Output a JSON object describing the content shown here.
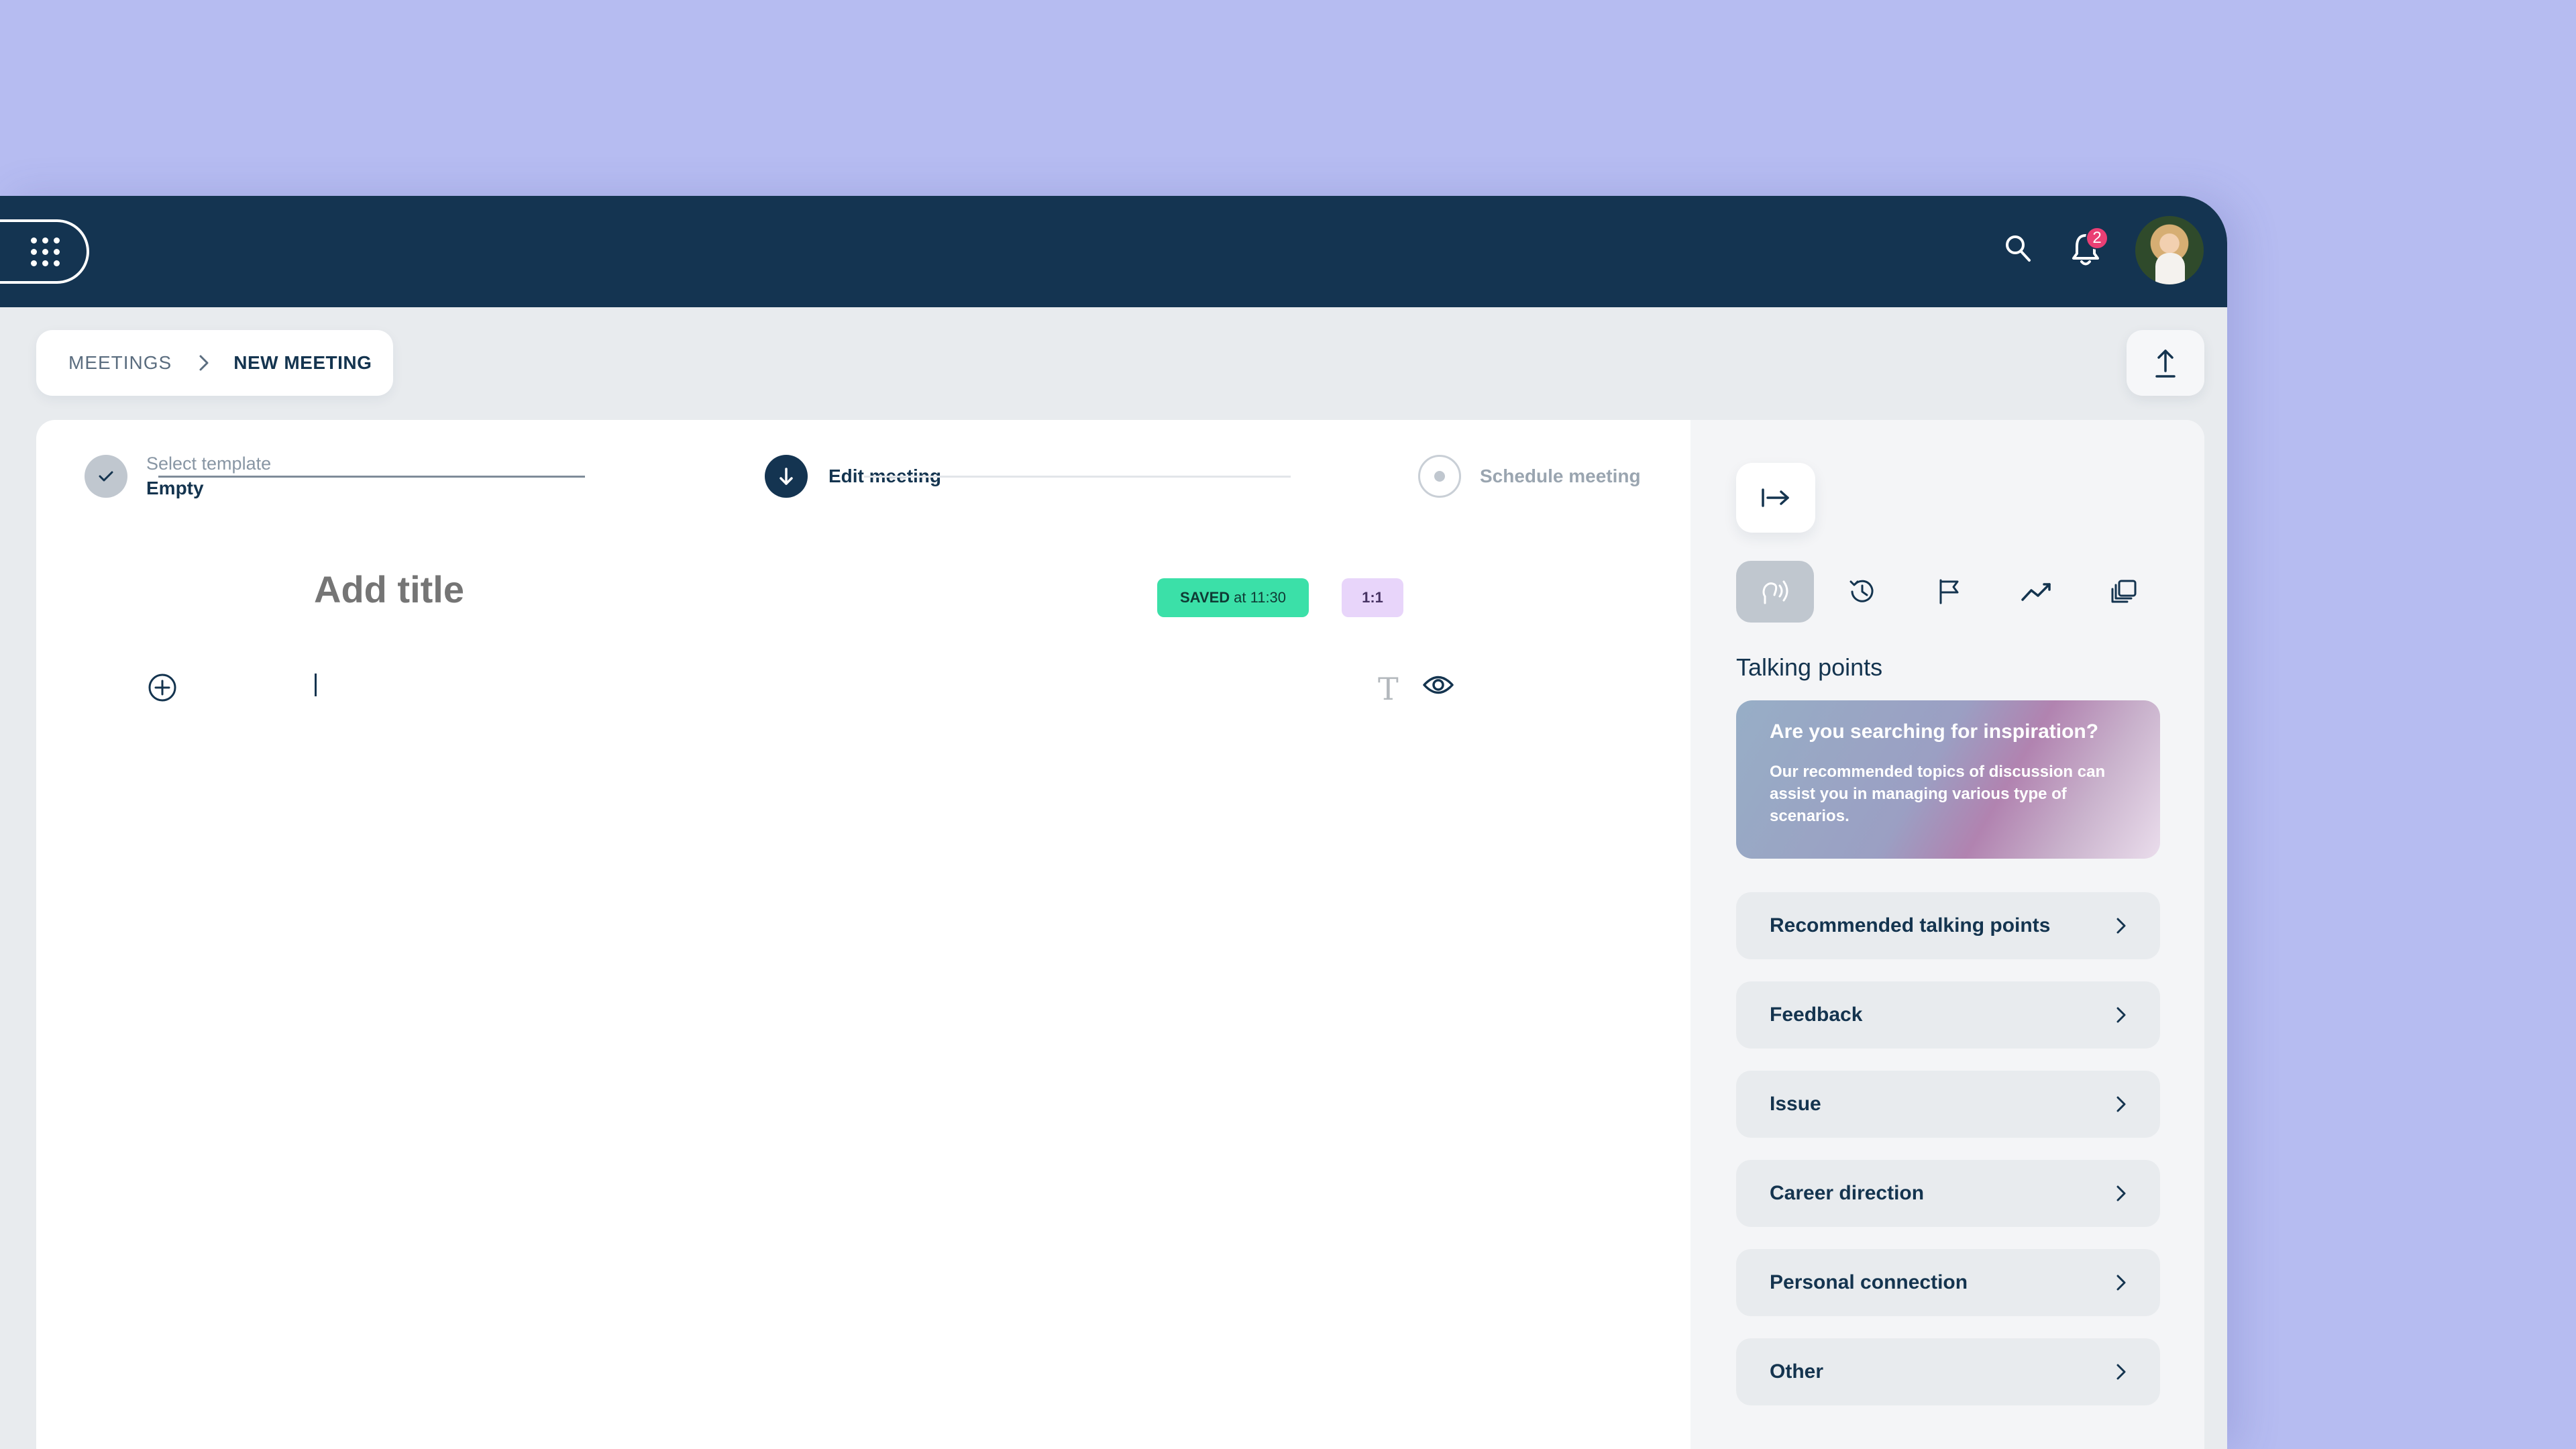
{
  "header": {
    "notification_count": "2"
  },
  "breadcrumb": {
    "parent": "MEETINGS",
    "current": "NEW MEETING"
  },
  "stepper": {
    "step1_label": "Select template",
    "step1_value": "Empty",
    "step2_label": "Edit meeting",
    "step3_label": "Schedule meeting"
  },
  "editor": {
    "title_placeholder": "Add title",
    "saved_badge_bold": "SAVED",
    "saved_badge_time": "at 11:30",
    "meeting_type_badge": "1:1"
  },
  "side_panel": {
    "title": "Talking points",
    "promo_title": "Are you searching for inspiration?",
    "promo_text": "Our recommended topics of discussion can assist you in managing various type of scenarios.",
    "categories": [
      "Recommended talking points",
      "Feedback",
      "Issue",
      "Career direction",
      "Personal connection",
      "Other"
    ]
  },
  "colors": {
    "background": "#b6bcf1",
    "topbar": "#143451",
    "saved_badge": "#3be0a8",
    "type_badge": "#e8d5fa",
    "notification": "#ea3f74"
  }
}
